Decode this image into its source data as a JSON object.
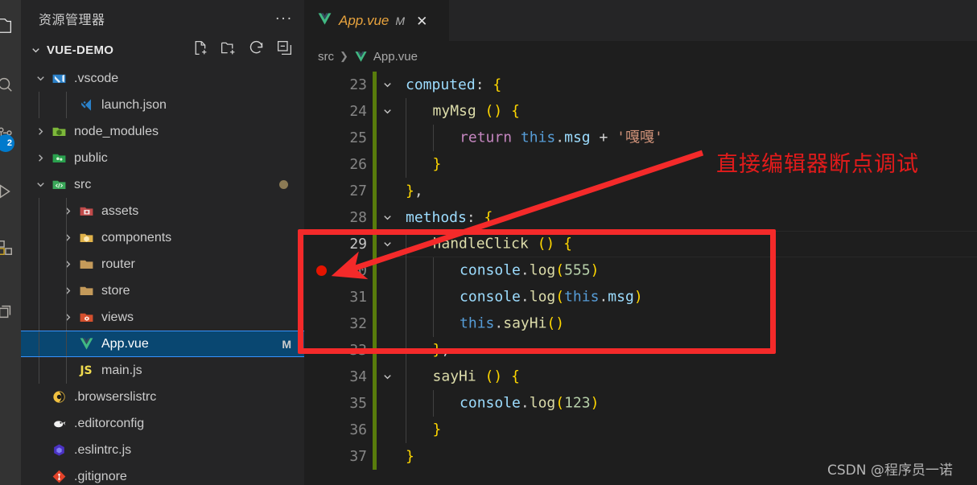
{
  "theme": {
    "editor_bg": "#1e1e1e",
    "sidebar_bg": "#252526",
    "activitybar_bg": "#333333",
    "selection_blue": "#094771",
    "accent_blue": "#007acc",
    "annotation_red": "#f42a2a",
    "breakpoint_red": "#e51400",
    "change_green": "#587c0c"
  },
  "activity_bar": {
    "badge_count": "2",
    "items": [
      {
        "name": "explorer-icon"
      },
      {
        "name": "search-icon"
      },
      {
        "name": "source-control-icon"
      },
      {
        "name": "run-and-debug-icon"
      },
      {
        "name": "extensions-icon"
      },
      {
        "name": "remote-explorer-icon"
      }
    ]
  },
  "sidebar": {
    "title": "资源管理器",
    "more_actions_label": "...",
    "section": {
      "name": "VUE-DEMO",
      "actions": [
        {
          "name": "new-file-icon",
          "label": "新建文件"
        },
        {
          "name": "new-folder-icon",
          "label": "新建文件夹"
        },
        {
          "name": "refresh-icon",
          "label": "刷新资源管理器"
        },
        {
          "name": "collapse-all-icon",
          "label": "在资源管理器中折叠文件夹"
        }
      ]
    },
    "tree": [
      {
        "label": ".vscode",
        "icon": "vscode-folder-icon",
        "depth": 1,
        "type": "folder",
        "expanded": true
      },
      {
        "label": "launch.json",
        "icon": "vscode-json-icon",
        "depth": 2,
        "type": "file"
      },
      {
        "label": "node_modules",
        "icon": "node-folder-icon",
        "depth": 1,
        "type": "folder",
        "expanded": false
      },
      {
        "label": "public",
        "icon": "public-folder-icon",
        "depth": 1,
        "type": "folder",
        "expanded": false
      },
      {
        "label": "src",
        "icon": "src-folder-icon",
        "depth": 1,
        "type": "folder",
        "expanded": true,
        "dirty": true
      },
      {
        "label": "assets",
        "icon": "assets-folder-icon",
        "depth": 2,
        "type": "folder",
        "expanded": false
      },
      {
        "label": "components",
        "icon": "components-folder-icon",
        "depth": 2,
        "type": "folder",
        "expanded": false
      },
      {
        "label": "router",
        "icon": "folder-icon",
        "depth": 2,
        "type": "folder",
        "expanded": false
      },
      {
        "label": "store",
        "icon": "folder-icon",
        "depth": 2,
        "type": "folder",
        "expanded": false
      },
      {
        "label": "views",
        "icon": "views-folder-icon",
        "depth": 2,
        "type": "folder",
        "expanded": false
      },
      {
        "label": "App.vue",
        "icon": "vue-icon",
        "depth": 2,
        "type": "file",
        "selected": true,
        "badge": "M"
      },
      {
        "label": "main.js",
        "icon": "js-icon",
        "depth": 2,
        "type": "file"
      },
      {
        "label": ".browserslistrc",
        "icon": "browserslist-icon",
        "depth": 1,
        "type": "file"
      },
      {
        "label": ".editorconfig",
        "icon": "editorconfig-icon",
        "depth": 1,
        "type": "file"
      },
      {
        "label": ".eslintrc.js",
        "icon": "eslint-icon",
        "depth": 1,
        "type": "file"
      },
      {
        "label": ".gitignore",
        "icon": "git-icon",
        "depth": 1,
        "type": "file"
      }
    ]
  },
  "editor": {
    "tab": {
      "name": "App.vue",
      "modified_badge": "M",
      "close_label": "✕",
      "icon": "vue-icon"
    },
    "breadcrumbs": [
      {
        "label": "src",
        "icon": null
      },
      {
        "label": "App.vue",
        "icon": "vue-icon"
      }
    ],
    "breadcrumb_separator": "❯",
    "lines": [
      {
        "num": "23",
        "fold": true,
        "indent": 0,
        "tokens": [
          {
            "t": "computed",
            "c": "t-var"
          },
          {
            "t": ": ",
            "c": "t-punc"
          },
          {
            "t": "{",
            "c": "t-paren1"
          }
        ]
      },
      {
        "num": "24",
        "fold": true,
        "indent": 1,
        "tokens": [
          {
            "t": "myMsg ",
            "c": "t-fn"
          },
          {
            "t": "()",
            "c": "t-paren1"
          },
          {
            "t": " ",
            "c": "t-plain"
          },
          {
            "t": "{",
            "c": "t-paren1"
          }
        ]
      },
      {
        "num": "25",
        "fold": false,
        "indent": 2,
        "tokens": [
          {
            "t": "return",
            "c": "t-ctrl"
          },
          {
            "t": " ",
            "c": "t-plain"
          },
          {
            "t": "this",
            "c": "t-this"
          },
          {
            "t": ".",
            "c": "t-punc"
          },
          {
            "t": "msg",
            "c": "t-var"
          },
          {
            "t": " ",
            "c": "t-plain"
          },
          {
            "t": "+",
            "c": "t-plain"
          },
          {
            "t": " ",
            "c": "t-plain"
          },
          {
            "t": "'嘎嘎'",
            "c": "t-str"
          }
        ]
      },
      {
        "num": "26",
        "fold": false,
        "indent": 1,
        "tokens": [
          {
            "t": "}",
            "c": "t-paren1"
          }
        ]
      },
      {
        "num": "27",
        "fold": false,
        "indent": 0,
        "tokens": [
          {
            "t": "}",
            "c": "t-paren1"
          },
          {
            "t": ",",
            "c": "t-punc"
          }
        ]
      },
      {
        "num": "28",
        "fold": true,
        "indent": 0,
        "tokens": [
          {
            "t": "methods",
            "c": "t-var"
          },
          {
            "t": ": ",
            "c": "t-punc"
          },
          {
            "t": "{",
            "c": "t-paren1"
          }
        ]
      },
      {
        "num": "29",
        "fold": true,
        "indent": 1,
        "current": true,
        "tokens": [
          {
            "t": "handleClick ",
            "c": "t-fn"
          },
          {
            "t": "()",
            "c": "t-paren1"
          },
          {
            "t": " ",
            "c": "t-plain"
          },
          {
            "t": "{",
            "c": "t-paren1"
          }
        ]
      },
      {
        "num": "30",
        "fold": false,
        "indent": 2,
        "breakpoint": true,
        "tokens": [
          {
            "t": "console",
            "c": "t-var"
          },
          {
            "t": ".",
            "c": "t-punc"
          },
          {
            "t": "log",
            "c": "t-fn"
          },
          {
            "t": "(",
            "c": "t-paren1"
          },
          {
            "t": "555",
            "c": "t-num"
          },
          {
            "t": ")",
            "c": "t-paren1"
          }
        ]
      },
      {
        "num": "31",
        "fold": false,
        "indent": 2,
        "tokens": [
          {
            "t": "console",
            "c": "t-var"
          },
          {
            "t": ".",
            "c": "t-punc"
          },
          {
            "t": "log",
            "c": "t-fn"
          },
          {
            "t": "(",
            "c": "t-paren1"
          },
          {
            "t": "this",
            "c": "t-this"
          },
          {
            "t": ".",
            "c": "t-punc"
          },
          {
            "t": "msg",
            "c": "t-var"
          },
          {
            "t": ")",
            "c": "t-paren1"
          }
        ]
      },
      {
        "num": "32",
        "fold": false,
        "indent": 2,
        "tokens": [
          {
            "t": "this",
            "c": "t-this"
          },
          {
            "t": ".",
            "c": "t-punc"
          },
          {
            "t": "sayHi",
            "c": "t-fn"
          },
          {
            "t": "()",
            "c": "t-paren1"
          }
        ]
      },
      {
        "num": "33",
        "fold": false,
        "indent": 1,
        "tokens": [
          {
            "t": "}",
            "c": "t-paren1"
          },
          {
            "t": ",",
            "c": "t-punc"
          }
        ]
      },
      {
        "num": "34",
        "fold": true,
        "indent": 1,
        "tokens": [
          {
            "t": "sayHi ",
            "c": "t-fn"
          },
          {
            "t": "()",
            "c": "t-paren1"
          },
          {
            "t": " ",
            "c": "t-plain"
          },
          {
            "t": "{",
            "c": "t-paren1"
          }
        ]
      },
      {
        "num": "35",
        "fold": false,
        "indent": 2,
        "tokens": [
          {
            "t": "console",
            "c": "t-var"
          },
          {
            "t": ".",
            "c": "t-punc"
          },
          {
            "t": "log",
            "c": "t-fn"
          },
          {
            "t": "(",
            "c": "t-paren1"
          },
          {
            "t": "123",
            "c": "t-num"
          },
          {
            "t": ")",
            "c": "t-paren1"
          }
        ]
      },
      {
        "num": "36",
        "fold": false,
        "indent": 1,
        "tokens": [
          {
            "t": "}",
            "c": "t-paren1"
          }
        ]
      },
      {
        "num": "37",
        "fold": false,
        "indent": 0,
        "tokens": [
          {
            "t": "}",
            "c": "t-paren1"
          }
        ]
      }
    ]
  },
  "annotations": {
    "callout_text": "直接编辑器断点调试",
    "watermark": "CSDN @程序员一诺"
  }
}
